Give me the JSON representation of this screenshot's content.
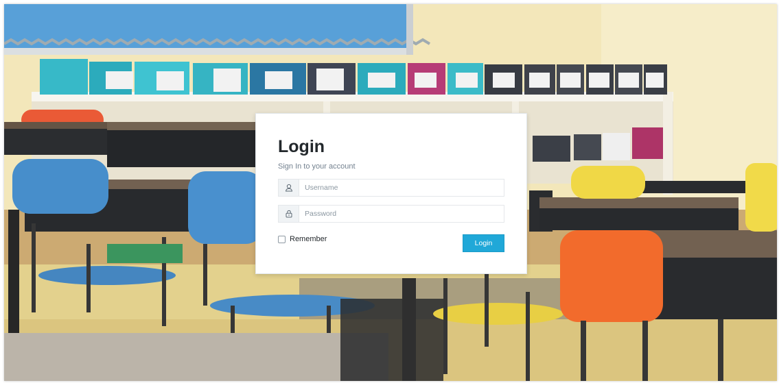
{
  "login": {
    "title": "Login",
    "subtitle": "Sign In to your account",
    "username_placeholder": "Username",
    "password_placeholder": "Password",
    "remember_label": "Remember",
    "button_label": "Login"
  },
  "icons": {
    "username": "user-icon",
    "password": "lock-icon"
  },
  "colors": {
    "accent": "#20a8d8",
    "title": "#23282c",
    "muted": "#73818f"
  }
}
